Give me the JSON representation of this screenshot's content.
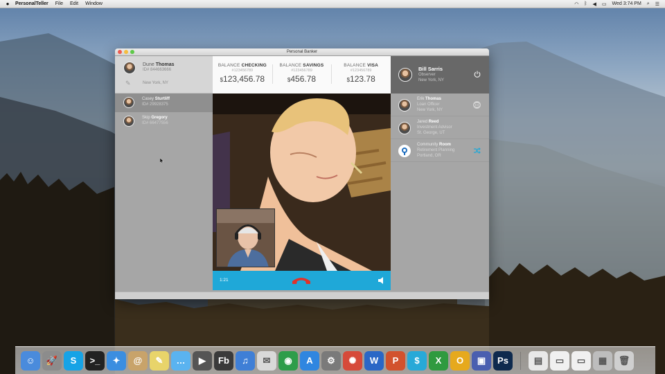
{
  "menubar": {
    "apple_icon": "apple-icon",
    "app_name": "PersonalTeller",
    "menus": [
      "File",
      "Edit",
      "Window"
    ],
    "clock": "Wed 3:74 PM"
  },
  "window": {
    "title": "Personal Banker"
  },
  "customer": {
    "first_name": "Dune",
    "last_name": "Thomas",
    "id": "ID# 844663666",
    "location": "New York, NY"
  },
  "queue": [
    {
      "first": "Casey",
      "last": "Sturtliff",
      "id": "ID# 29928375"
    },
    {
      "first": "Skip",
      "last": "Gregory",
      "id": "ID# 66477556"
    }
  ],
  "balances": [
    {
      "label_pre": "BALANCE",
      "label": "CHECKING",
      "acct": "#123456789",
      "currency": "$",
      "amount": "123,456.78"
    },
    {
      "label_pre": "BALANCE",
      "label": "SAVINGS",
      "acct": "#123456789",
      "currency": "$",
      "amount": "456.78"
    },
    {
      "label_pre": "BALANCE",
      "label": "VISA",
      "acct": "#123456789",
      "currency": "$",
      "amount": "123.78"
    }
  ],
  "call": {
    "timer": "1:21"
  },
  "agent": {
    "name": "Bill Sarris",
    "role": "Observer",
    "location": "New York, NY"
  },
  "contacts": [
    {
      "first": "Erik",
      "last": "Thomas",
      "role": "Loan Officer",
      "location": "New York, NY",
      "action_icon": "eye-icon"
    },
    {
      "first": "Jared",
      "last": "Reed",
      "role": "Investment Advisor",
      "location": "St. George, UT",
      "action_icon": ""
    },
    {
      "first": "Community",
      "last": "Room",
      "role": "Retirement Planning",
      "location": "Portland, OR",
      "action_icon": "shuffle-icon"
    }
  ],
  "colors": {
    "accent": "#1fa8d8",
    "hangup": "#e0322b"
  },
  "dock": {
    "items": [
      {
        "name": "finder",
        "glyph": "☺",
        "color": "#4a8bdc"
      },
      {
        "name": "launchpad",
        "glyph": "🚀",
        "color": "#8c8c8c"
      },
      {
        "name": "skype",
        "glyph": "S",
        "color": "#16a3e6"
      },
      {
        "name": "terminal",
        "glyph": ">_",
        "color": "#222222"
      },
      {
        "name": "safari",
        "glyph": "✦",
        "color": "#3b8ee0"
      },
      {
        "name": "contacts",
        "glyph": "@",
        "color": "#c8a36a"
      },
      {
        "name": "stickies",
        "glyph": "✎",
        "color": "#e8d46a"
      },
      {
        "name": "messages",
        "glyph": "…",
        "color": "#5ab3f0"
      },
      {
        "name": "facetime",
        "glyph": "▶",
        "color": "#555555"
      },
      {
        "name": "flash-builder",
        "glyph": "Fb",
        "color": "#3a3a3a"
      },
      {
        "name": "itunes",
        "glyph": "♫",
        "color": "#3f7fd6"
      },
      {
        "name": "preview",
        "glyph": "✉",
        "color": "#d9d9d9"
      },
      {
        "name": "chrome",
        "glyph": "◉",
        "color": "#2e9d4a"
      },
      {
        "name": "app-store",
        "glyph": "A",
        "color": "#2f86e0"
      },
      {
        "name": "system-preferences",
        "glyph": "⚙",
        "color": "#7a7a7a"
      },
      {
        "name": "photo-booth",
        "glyph": "✺",
        "color": "#d64a3a"
      },
      {
        "name": "word",
        "glyph": "W",
        "color": "#2a67c6"
      },
      {
        "name": "powerpoint",
        "glyph": "P",
        "color": "#d2522d"
      },
      {
        "name": "personal-teller",
        "glyph": "$",
        "color": "#28a9d8"
      },
      {
        "name": "excel",
        "glyph": "X",
        "color": "#2f9a3f"
      },
      {
        "name": "outlook",
        "glyph": "O",
        "color": "#e6a91d"
      },
      {
        "name": "virtual-machine",
        "glyph": "▣",
        "color": "#4a5fb0"
      },
      {
        "name": "photoshop",
        "glyph": "Ps",
        "color": "#0e2a4e"
      }
    ],
    "stack_items": [
      {
        "name": "document-stack",
        "glyph": "▤",
        "color": "#e8e8e8"
      },
      {
        "name": "downloads-stack",
        "glyph": "▭",
        "color": "#f0f0f0"
      },
      {
        "name": "folder-stack",
        "glyph": "▭",
        "color": "#f0f0f0"
      },
      {
        "name": "pictures-stack",
        "glyph": "▦",
        "color": "#bdbdbd"
      },
      {
        "name": "trash",
        "glyph": "🗑",
        "color": "#cfcfcf"
      }
    ]
  }
}
